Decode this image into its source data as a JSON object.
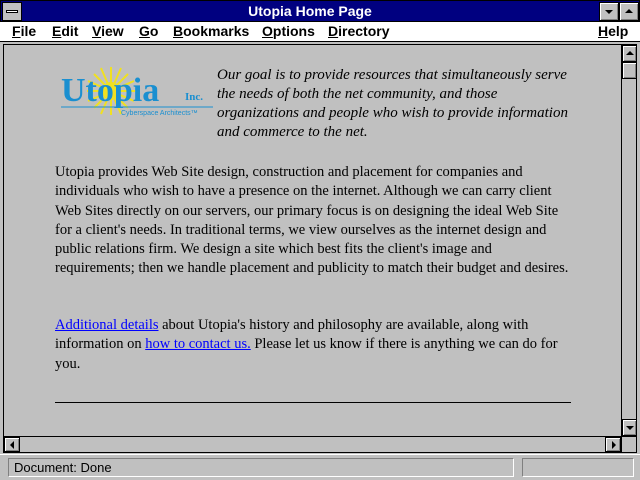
{
  "window": {
    "title": "Utopia Home Page"
  },
  "menu": {
    "items": [
      {
        "mnemonic": "F",
        "rest": "ile"
      },
      {
        "mnemonic": "E",
        "rest": "dit"
      },
      {
        "mnemonic": "V",
        "rest": "iew"
      },
      {
        "mnemonic": "G",
        "rest": "o"
      },
      {
        "mnemonic": "B",
        "rest": "ookmarks"
      },
      {
        "mnemonic": "O",
        "rest": "ptions"
      },
      {
        "mnemonic": "D",
        "rest": "irectory"
      },
      {
        "mnemonic": "H",
        "rest": "elp"
      }
    ]
  },
  "logo": {
    "name": "Utopia",
    "suffix": "Inc.",
    "subtitle": "Cyberspace Architects™",
    "colors": {
      "text": "#1a8fd0",
      "sun": "#f0e020",
      "accent": "#1a8fd0"
    }
  },
  "tagline": "Our goal is to provide resources that simultaneously serve the needs of both the net community, and those organizations and people who wish to provide information and commerce to the net.",
  "body": {
    "para1": "Utopia provides Web Site design, construction and placement for companies and individuals who wish to have a presence on the internet. Although we can carry client Web Sites directly on our servers, our primary focus is on designing the ideal Web Site for a client's needs. In traditional terms, we view ourselves as the internet design and public relations firm. We design a site which best fits the client's image and requirements; then we handle placement and publicity to match their budget and desires.",
    "para2": {
      "link1": "Additional details",
      "text1": " about Utopia's history and philosophy are available, along with information on ",
      "link2": "how to contact us.",
      "text2": " Please let us know if there is anything we can do for you."
    }
  },
  "status": {
    "text": "Document: Done"
  },
  "colors": {
    "link": "#0000ff",
    "titlebar": "#000080",
    "background": "#c0c0c0"
  }
}
